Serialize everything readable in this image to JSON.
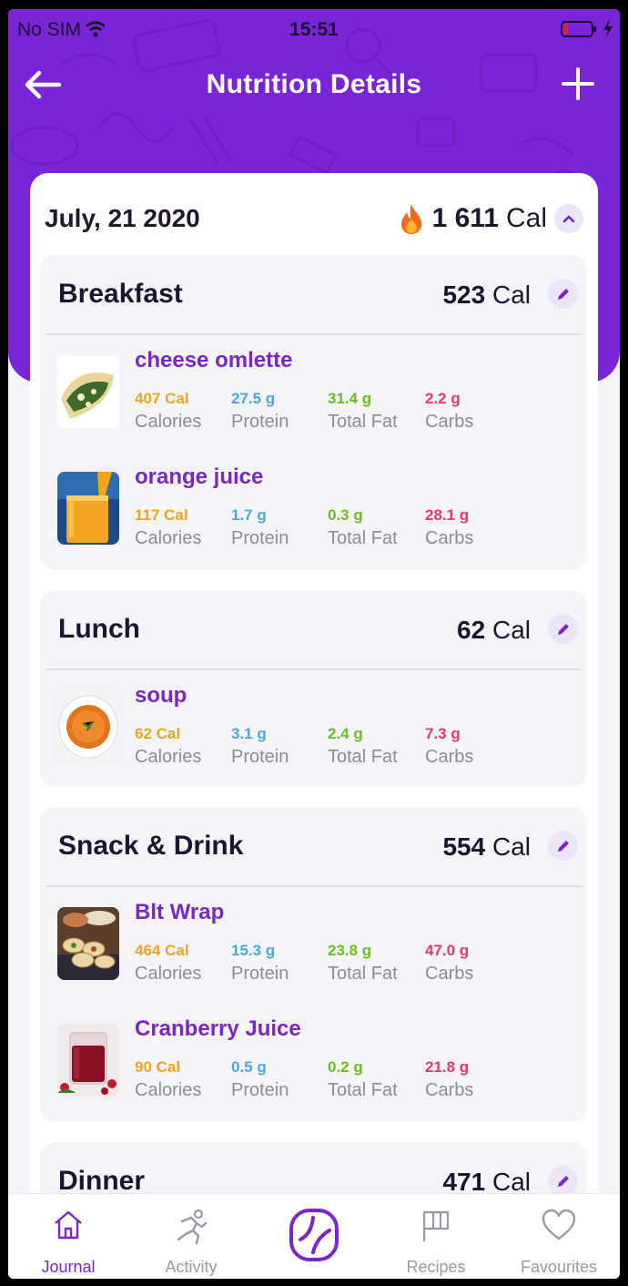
{
  "status_bar": {
    "carrier": "No SIM",
    "time": "15:51"
  },
  "header": {
    "title": "Nutrition Details"
  },
  "summary": {
    "date": "July, 21 2020",
    "total_calories": "1 611",
    "unit": "Cal"
  },
  "nutrient_labels": {
    "calories": "Calories",
    "protein": "Protein",
    "fat": "Total Fat",
    "carbs": "Carbs"
  },
  "meals": [
    {
      "name": "Breakfast",
      "calories": "523",
      "unit": "Cal",
      "foods": [
        {
          "name": "cheese omlette",
          "calories": "407 Cal",
          "protein": "27.5 g",
          "fat": "31.4  g",
          "carbs": "2.2  g"
        },
        {
          "name": "orange juice",
          "calories": "117 Cal",
          "protein": "1.7 g",
          "fat": "0.3  g",
          "carbs": "28.1  g"
        }
      ]
    },
    {
      "name": "Lunch",
      "calories": "62",
      "unit": "Cal",
      "foods": [
        {
          "name": "soup",
          "calories": "62 Cal",
          "protein": "3.1 g",
          "fat": "2.4  g",
          "carbs": "7.3  g"
        }
      ]
    },
    {
      "name": "Snack & Drink",
      "calories": "554",
      "unit": "Cal",
      "foods": [
        {
          "name": "Blt Wrap",
          "calories": "464 Cal",
          "protein": "15.3 g",
          "fat": "23.8  g",
          "carbs": "47.0  g"
        },
        {
          "name": "Cranberry Juice",
          "calories": "90 Cal",
          "protein": "0.5 g",
          "fat": "0.2  g",
          "carbs": "21.8  g"
        }
      ]
    },
    {
      "name": "Dinner",
      "calories": "471",
      "unit": "Cal",
      "foods": []
    }
  ],
  "tabs": [
    {
      "label": "Journal",
      "icon": "home-icon",
      "active": true
    },
    {
      "label": "Activity",
      "icon": "running-icon",
      "active": false
    },
    {
      "label": "",
      "icon": "app-logo-icon",
      "active": false
    },
    {
      "label": "Recipes",
      "icon": "flag-icon",
      "active": false
    },
    {
      "label": "Favourites",
      "icon": "heart-icon",
      "active": false
    }
  ],
  "colors": {
    "brand_purple": "#7a24d8",
    "calories": "#f0a421",
    "protein": "#4aa8e3",
    "fat": "#68c020",
    "carbs": "#e8357a",
    "food_name": "#7a26c9"
  }
}
